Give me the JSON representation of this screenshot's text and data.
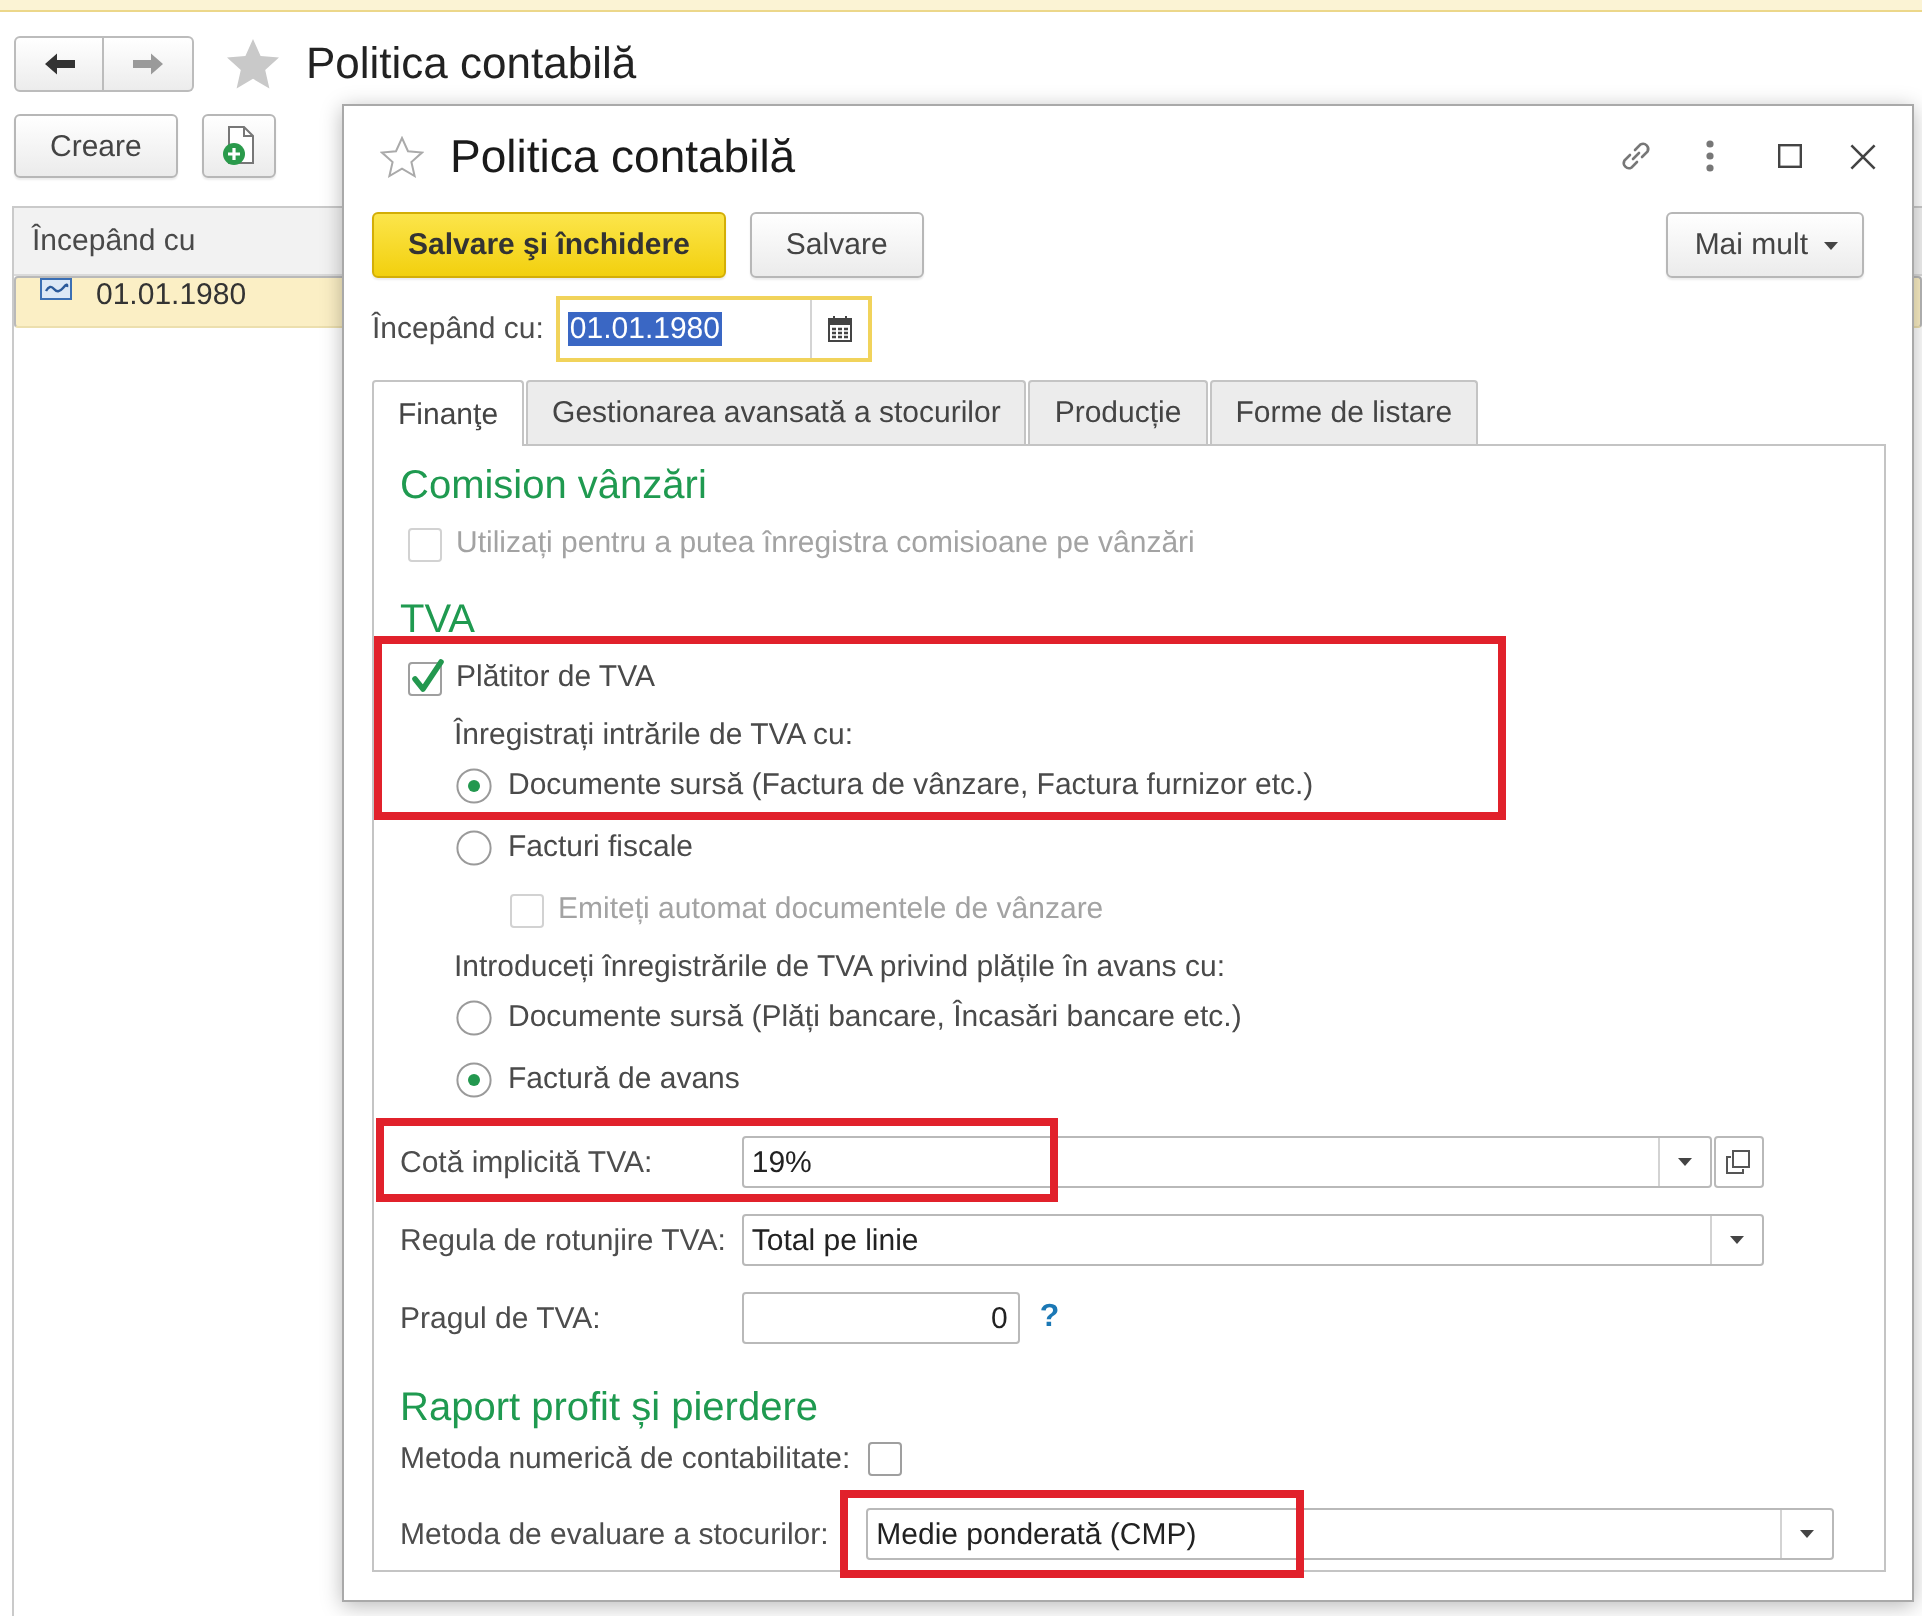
{
  "page": {
    "title": "Politica contabilă",
    "toolbar": {
      "create_button": "Creare"
    },
    "list": {
      "columns": [
        "Începând cu"
      ],
      "rows": [
        {
          "cells": [
            "01.01.1980"
          ],
          "selected": true
        }
      ]
    }
  },
  "dialog": {
    "title": "Politica contabilă",
    "actions": [
      {
        "label": "Salvare şi închidere",
        "kind": "primary"
      },
      {
        "label": "Salvare",
        "kind": "secondary"
      }
    ],
    "more_button": "Mai mult",
    "date_field": {
      "label": "Începând cu:",
      "value": "01.01.1980"
    },
    "tabs": [
      {
        "label": "Finanţe",
        "selected": true
      },
      {
        "label": "Gestionarea avansată a stocurilor",
        "selected": false
      },
      {
        "label": "Producție",
        "selected": false
      },
      {
        "label": "Forme de listare",
        "selected": false
      }
    ],
    "sections": [
      {
        "title": "Comision vânzări",
        "items": [
          {
            "kind": "checkbox",
            "label": "Utilizați pentru a putea înregistra comisioane pe vânzări",
            "checked": false,
            "disabled": true
          }
        ]
      },
      {
        "title": "TVA",
        "items": [
          {
            "kind": "group",
            "highlighted": true,
            "items": [
              {
                "kind": "checkbox",
                "label": "Plătitor de TVA",
                "checked": true,
                "disabled": false
              },
              {
                "kind": "caption",
                "label": "Înregistrați intrările de TVA cu:"
              },
              {
                "kind": "radio",
                "label": "Documente sursă (Factura de vânzare, Factura furnizor etc.)",
                "selected": true
              }
            ]
          },
          {
            "kind": "radio",
            "label": "Facturi fiscale",
            "selected": false,
            "children": [
              {
                "kind": "checkbox",
                "label": "Emiteți automat documentele de vânzare",
                "checked": false,
                "disabled": true
              }
            ]
          },
          {
            "kind": "caption",
            "label": "Introduceți înregistrările de TVA privind plățile în avans cu:"
          },
          {
            "kind": "radio",
            "label": "Documente sursă (Plăți bancare, Încasări bancare etc.)",
            "selected": false
          },
          {
            "kind": "radio",
            "label": "Factură de avans",
            "selected": true
          },
          {
            "kind": "combo",
            "label": "Cotă implicită TVA:",
            "value": "19%",
            "highlight": {
              "kind": "row"
            }
          },
          {
            "kind": "select",
            "label": "Regula de rotunjire TVA:",
            "value": "Total pe linie"
          },
          {
            "kind": "number",
            "label": "Pragul de TVA:",
            "value": "0",
            "help": "?"
          }
        ]
      },
      {
        "title": "Raport profit și pierdere",
        "items": [
          {
            "kind": "check_field",
            "label": "Metoda numerică de contabilitate:",
            "checked": false
          },
          {
            "kind": "select",
            "label": "Metoda de evaluare a stocurilor:",
            "value": "Medie ponderată (CMP)",
            "highlight": {
              "kind": "value"
            }
          }
        ]
      }
    ]
  }
}
